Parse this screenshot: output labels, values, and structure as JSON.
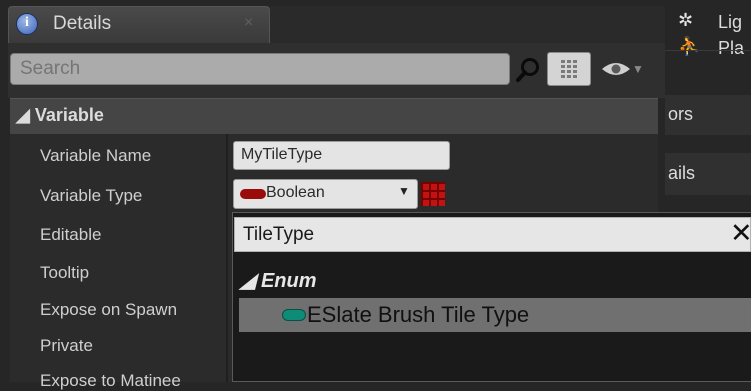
{
  "details_tab": {
    "title": "Details",
    "close": "×"
  },
  "search": {
    "placeholder": "Search"
  },
  "section": {
    "label": "◢ Variable"
  },
  "properties": [
    {
      "label": "Variable Name"
    },
    {
      "label": "Variable Type"
    },
    {
      "label": "Editable"
    },
    {
      "label": "Tooltip"
    },
    {
      "label": "Expose on Spawn"
    },
    {
      "label": "Private"
    },
    {
      "label": "Expose to Matinee"
    }
  ],
  "variable_name": {
    "value": "MyTileType"
  },
  "variable_type": {
    "value": "Boolean",
    "pill_color": "#9a0b0b",
    "icon": "container-grid-icon"
  },
  "right_panel": {
    "items": [
      {
        "icon": "light-icon",
        "label": "Lig"
      },
      {
        "icon": "play-icon",
        "label": "Pla"
      },
      {
        "label": "ors"
      },
      {
        "label": "ails"
      }
    ]
  },
  "type_picker": {
    "search_value": "TileType",
    "clear": "✕",
    "category": "◢ Enum",
    "result": {
      "label": "ESlate Brush Tile Type",
      "pill_color": "#0f8c78"
    }
  },
  "colors": {
    "background": "#262626",
    "header": "#454545",
    "highlight_row": "#707070"
  }
}
